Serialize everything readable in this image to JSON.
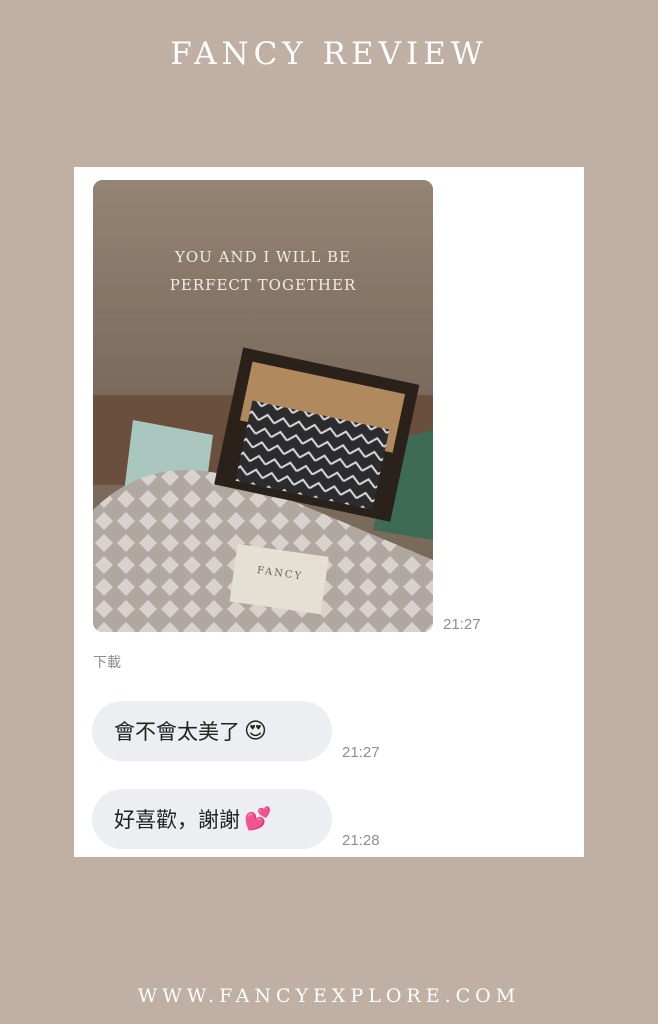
{
  "header": {
    "title": "FANCY REVIEW"
  },
  "chat": {
    "photo": {
      "box_text_line1": "YOU AND I WILL BE",
      "box_text_line2": "PERFECT TOGETHER",
      "tag_text": "FANCY",
      "time": "21:27"
    },
    "download_label": "下載",
    "messages": [
      {
        "text": "會不會太美了",
        "emoji": "😍",
        "time": "21:27"
      },
      {
        "text": "好喜歡，謝謝",
        "emoji": "💕",
        "time": "21:28"
      }
    ]
  },
  "footer": {
    "url": "WWW.FANCYEXPLORE.COM"
  }
}
